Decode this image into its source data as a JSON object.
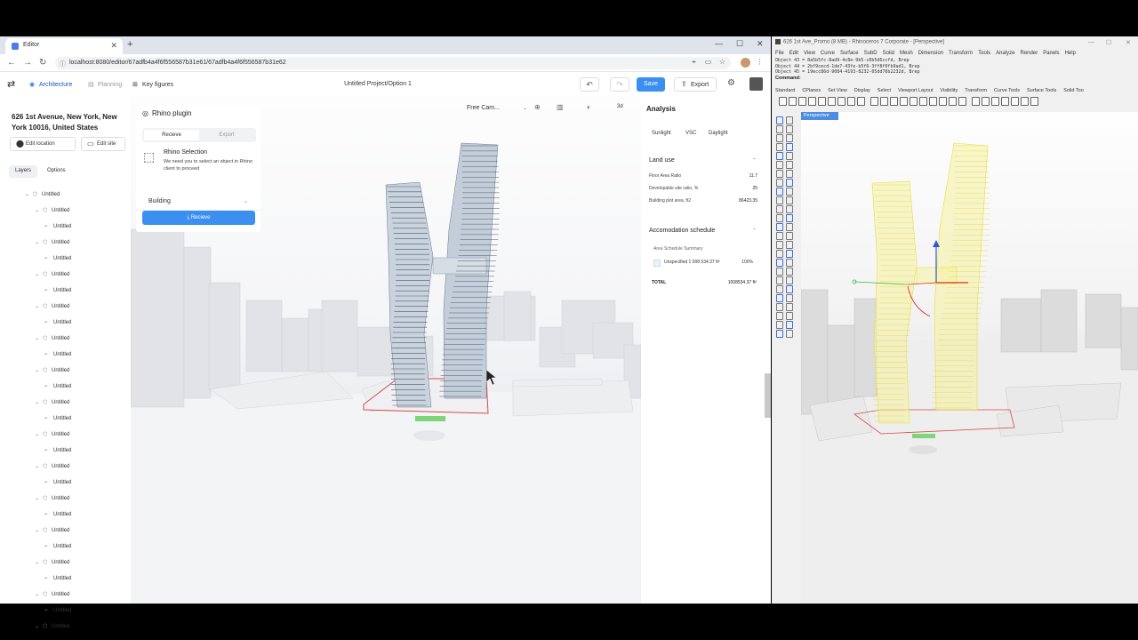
{
  "browser": {
    "tab_title": "Editor",
    "url": "localhost:8080/editor/67adfb4a4f6f556587b31e61/67adfb4a4f6f556587b31e62"
  },
  "app": {
    "tabs": [
      {
        "label": "Architecture",
        "icon": "architecture-icon",
        "active": true
      },
      {
        "label": "Planning",
        "icon": "planning-icon",
        "active": false
      },
      {
        "label": "Key figures",
        "icon": "key-figures-icon",
        "active": false
      }
    ],
    "project_title": "Untitled Project/Option 1",
    "save_label": "Save",
    "export_label": "Export",
    "accent_color": "#3b8ff1"
  },
  "left_panel": {
    "address": "626 1st Avenue, New York, New York 10016, United States",
    "edit_location": "Edit location",
    "edit_site": "Edit site",
    "tabs": [
      "Layers",
      "Options"
    ],
    "layers": [
      {
        "label": "Untitled",
        "level": 0
      },
      {
        "label": "Untitled",
        "level": 1
      },
      {
        "label": "Untitled",
        "level": 2
      },
      {
        "label": "Untitled",
        "level": 1
      },
      {
        "label": "Untitled",
        "level": 2
      },
      {
        "label": "Untitled",
        "level": 1
      },
      {
        "label": "Untitled",
        "level": 2
      },
      {
        "label": "Untitled",
        "level": 1
      },
      {
        "label": "Untitled",
        "level": 2
      },
      {
        "label": "Untitled",
        "level": 1
      },
      {
        "label": "Untitled",
        "level": 2
      },
      {
        "label": "Untitled",
        "level": 1
      },
      {
        "label": "Untitled",
        "level": 2
      },
      {
        "label": "Untitled",
        "level": 1
      },
      {
        "label": "Untitled",
        "level": 2
      },
      {
        "label": "Untitled",
        "level": 1
      },
      {
        "label": "Untitled",
        "level": 2
      },
      {
        "label": "Untitled",
        "level": 1
      },
      {
        "label": "Untitled",
        "level": 2
      },
      {
        "label": "Untitled",
        "level": 1
      },
      {
        "label": "Untitled",
        "level": 2
      },
      {
        "label": "Untitled",
        "level": 1
      },
      {
        "label": "Untitled",
        "level": 2
      },
      {
        "label": "Untitled",
        "level": 1
      },
      {
        "label": "Untitled",
        "level": 2
      },
      {
        "label": "Untitled",
        "level": 1
      },
      {
        "label": "Untitled",
        "level": 2
      },
      {
        "label": "Untitled",
        "level": 1
      }
    ]
  },
  "plugin": {
    "title": "Rhino plugin",
    "tabs": [
      "Recieve",
      "Export"
    ],
    "selection_title": "Rhino Selection",
    "selection_desc": "We need you to select an object in Rhino client to proceed",
    "building_select": "Building",
    "recieve_button": "Recieve"
  },
  "viewport": {
    "camera": "Free Cam...",
    "mode": "3d"
  },
  "analysis": {
    "title": "Analysis",
    "tabs": [
      "Sunlight",
      "VSC",
      "Daylight"
    ],
    "land_use": {
      "title": "Land use",
      "rows": [
        {
          "label": "Floor Area Ratio",
          "value": "11.7"
        },
        {
          "label": "Developable site ratio, %",
          "value": "25"
        },
        {
          "label": "Building plot area, ft2",
          "value": "86423.35"
        }
      ]
    },
    "schedule": {
      "title": "Accomodation schedule",
      "summary_label": "Area Schedule Summary",
      "row": {
        "label": "Unspecified 1 008 534.37 ft²",
        "value": "100%"
      },
      "total_label": "TOTAL",
      "total_value": "1008534.37 ft²"
    }
  },
  "rhino": {
    "title": "626 1st Ave_Promo (8 MB) - Rhinoceros 7 Corporate - [Perspective]",
    "menu": [
      "File",
      "Edit",
      "View",
      "Curve",
      "Surface",
      "SubD",
      "Solid",
      "Mesh",
      "Dimension",
      "Transform",
      "Tools",
      "Analyze",
      "Render",
      "Panels",
      "Help"
    ],
    "history": [
      "Object 43 = 8a5b5fc-8ad9-4c8e-9b5-c0b5d6ccfd, Brep",
      "Object 44 = 2bf9cecd-1de7-43fe-b5f6-3ff8f0fb9ad1, Brep",
      "Object 45 = 19ecc86d-9084-4193-8232-05dd76b2232d, Brep"
    ],
    "command_label": "Command:",
    "tabs": [
      "Standard",
      "CPlanes",
      "Set View",
      "Display",
      "Select",
      "Viewport Layout",
      "Visibility",
      "Transform",
      "Curve Tools",
      "Surface Tools",
      "Solid Too"
    ],
    "viewport_label": "Perspective",
    "selection_color": "#f2f25a"
  }
}
